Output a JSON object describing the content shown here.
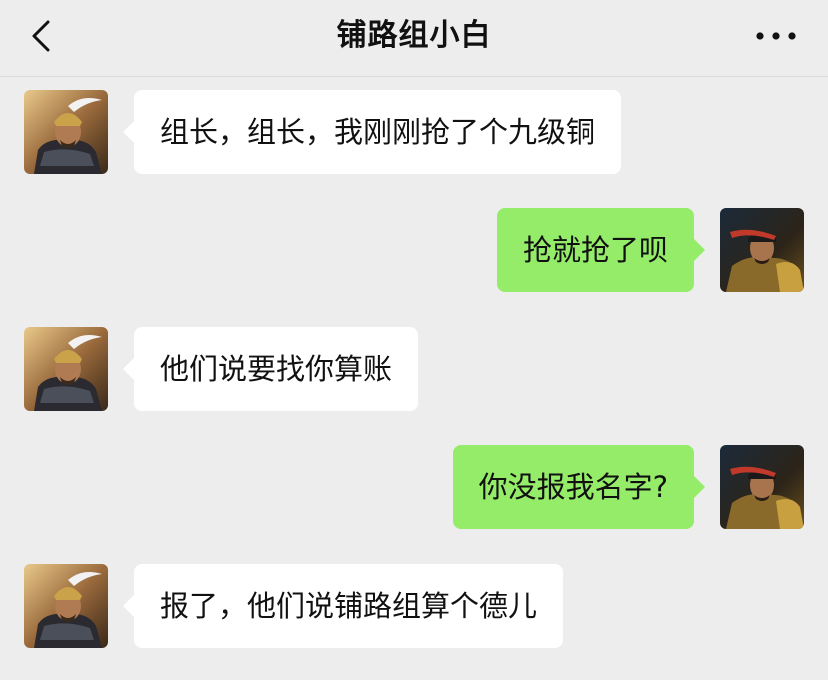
{
  "header": {
    "title": "铺路组小白",
    "back_icon": "chevron-left-icon",
    "more_icon": "more-dots-icon"
  },
  "contacts": {
    "other_avatar": "general-avatar-white-plume",
    "self_avatar": "general-avatar-red-headband"
  },
  "messages": [
    {
      "sender": "other",
      "text": "组长，组长，我刚刚抢了个九级铜"
    },
    {
      "sender": "self",
      "text": "抢就抢了呗"
    },
    {
      "sender": "other",
      "text": "他们说要找你算账"
    },
    {
      "sender": "self",
      "text": "你没报我名字?"
    },
    {
      "sender": "other",
      "text": "报了，他们说铺路组算个德儿"
    }
  ],
  "colors": {
    "background": "#ededed",
    "self_bubble": "#95ec69",
    "other_bubble": "#ffffff"
  }
}
